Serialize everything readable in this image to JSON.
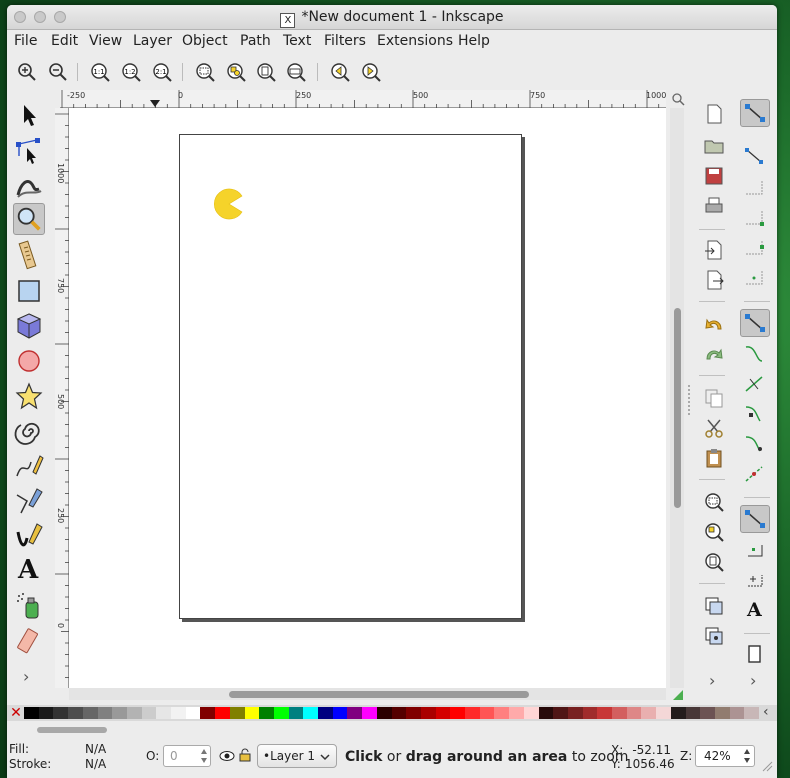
{
  "window": {
    "title": "*New document 1 - Inkscape",
    "x11_glyph": "X"
  },
  "menubar": [
    "File",
    "Edit",
    "View",
    "Layer",
    "Object",
    "Path",
    "Text",
    "Filters",
    "Extensions",
    "Help"
  ],
  "commands": [
    {
      "name": "zoom-in-icon"
    },
    {
      "name": "zoom-out-icon"
    },
    {
      "name": "zoom-1-1-icon",
      "label": "1:1"
    },
    {
      "name": "zoom-1-2-icon",
      "label": "1:2"
    },
    {
      "name": "zoom-2-1-icon",
      "label": "2:1"
    },
    {
      "name": "zoom-selection-icon"
    },
    {
      "name": "zoom-drawing-icon"
    },
    {
      "name": "zoom-page-icon"
    },
    {
      "name": "zoom-page-width-icon"
    },
    {
      "name": "zoom-prev-icon"
    },
    {
      "name": "zoom-next-icon"
    }
  ],
  "rulers": {
    "horizontal": [
      "-250",
      "0",
      "250",
      "500",
      "750",
      "1000"
    ],
    "vertical": [
      "1000",
      "750",
      "500",
      "250",
      "0"
    ]
  },
  "tools": [
    "selector-tool",
    "node-tool",
    "tweak-tool",
    "zoom-tool",
    "measure-tool",
    "rectangle-tool",
    "3d-box-tool",
    "ellipse-tool",
    "star-tool",
    "spiral-tool",
    "pencil-tool",
    "pen-tool",
    "calligraphy-tool",
    "text-tool",
    "spray-tool",
    "eraser-tool"
  ],
  "tools_active": "zoom-tool",
  "text_tool_glyph": "A",
  "more_glyph": "›",
  "palette": {
    "none_glyph": "✕",
    "scroll_glyph": "‹",
    "colors": [
      "#000000",
      "#1a1a1a",
      "#333333",
      "#4d4d4d",
      "#666666",
      "#808080",
      "#999999",
      "#b3b3b3",
      "#cccccc",
      "#e6e6e6",
      "#f2f2f2",
      "#ffffff",
      "#800000",
      "#ff0000",
      "#808000",
      "#ffff00",
      "#008000",
      "#00ff00",
      "#008080",
      "#00ffff",
      "#000080",
      "#0000ff",
      "#800080",
      "#ff00ff",
      "#2b0000",
      "#550000",
      "#800000",
      "#aa0000",
      "#d40000",
      "#ff0000",
      "#ff2a2a",
      "#ff5555",
      "#ff8080",
      "#ffaaaa",
      "#ffd5d5",
      "#280b0b",
      "#501616",
      "#782121",
      "#a02c2c",
      "#c83737",
      "#d35f5f",
      "#de8787",
      "#e9afaf",
      "#f4d7d7",
      "#241c1c",
      "#483737",
      "#6c5353",
      "#917c6f",
      "#ac9393",
      "#c8b7b7"
    ]
  },
  "status": {
    "fill_label": "Fill:",
    "fill_value": "N/A",
    "stroke_label": "Stroke:",
    "stroke_value": "N/A",
    "opacity_label": "O:",
    "opacity_value": "0",
    "layer": "•Layer 1",
    "message_parts": [
      "Click",
      " or ",
      "drag around an area",
      " to zoom"
    ],
    "x_label": "X:",
    "x_value": "-52.11",
    "y_label": "Y:",
    "y_value": "1056.46",
    "zoom_label": "Z:",
    "zoom_value": "42%"
  },
  "colors": {
    "pacman": "#f5d32a",
    "active_tool_bg": "#c8c8c8"
  }
}
